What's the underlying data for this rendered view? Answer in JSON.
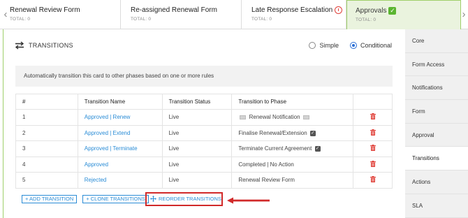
{
  "phases": [
    {
      "name": "Renewal Review Form",
      "total": "TOTAL: 0",
      "emoji": ""
    },
    {
      "name": "Re-assigned Renewal Form",
      "total": "TOTAL: 0",
      "emoji": ""
    },
    {
      "name": "Late Response Escalation",
      "total": "TOTAL: 0",
      "emoji": "alarm-clock"
    },
    {
      "name": "Approvals",
      "total": "TOTAL: 0",
      "emoji": "green-check",
      "active": true
    }
  ],
  "header": {
    "title": "TRANSITIONS",
    "icon": "transfer-arrows-icon",
    "mode_options": [
      "Simple",
      "Conditional"
    ],
    "mode_selected": "Conditional"
  },
  "info_text": "Automatically transition this card to other phases based on one or more rules",
  "table": {
    "columns": [
      "#",
      "Transition Name",
      "Transition Status",
      "Transition to Phase",
      ""
    ],
    "rows": [
      {
        "num": "1",
        "name": "Approved | Renew",
        "status": "Live",
        "phase": "Renewal Notification",
        "phase_deco": "mail"
      },
      {
        "num": "2",
        "name": "Approved | Extend",
        "status": "Live",
        "phase": "Finalise Renewal/Extension",
        "phase_deco": "check"
      },
      {
        "num": "3",
        "name": "Approved | Terminate",
        "status": "Live",
        "phase": "Terminate Current Agreement",
        "phase_deco": "check"
      },
      {
        "num": "4",
        "name": "Approved",
        "status": "Live",
        "phase": "Completed | No Action",
        "phase_deco": ""
      },
      {
        "num": "5",
        "name": "Rejected",
        "status": "Live",
        "phase": "Renewal Review Form",
        "phase_deco": ""
      }
    ]
  },
  "buttons": {
    "add": "+ ADD TRANSITION",
    "clone": "+ CLONE TRANSITIONS",
    "reorder": "REORDER TRANSITIONS"
  },
  "sidebar": {
    "items": [
      "Core",
      "Form Access",
      "Notifications",
      "Form",
      "Approval",
      "Transitions",
      "Actions",
      "SLA"
    ],
    "active": "Transitions"
  },
  "colors": {
    "accent_blue": "#2a8cd6",
    "active_green": "#eaf3de",
    "delete_red": "#e0413a",
    "highlight_red": "#d12a2a"
  }
}
